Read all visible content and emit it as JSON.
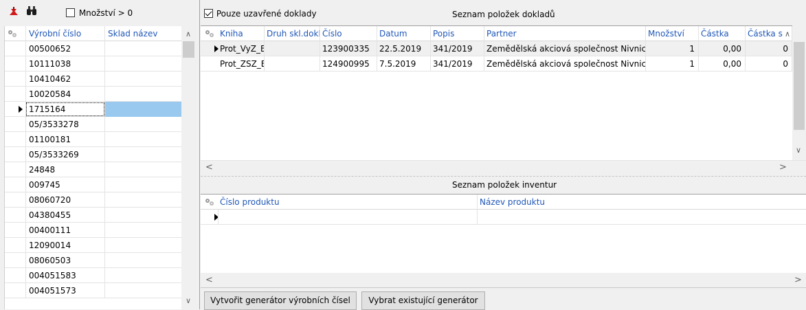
{
  "left": {
    "toolbar": {
      "quantity_filter_label": "Množství > 0"
    },
    "columns": [
      "Výrobní číslo",
      "Sklad název"
    ],
    "rows": [
      {
        "serial": "00500652",
        "warehouse": ""
      },
      {
        "serial": "10111038",
        "warehouse": ""
      },
      {
        "serial": "10410462",
        "warehouse": ""
      },
      {
        "serial": "10020584",
        "warehouse": ""
      },
      {
        "serial": "1715164",
        "warehouse": ""
      },
      {
        "serial": "05/3533278",
        "warehouse": ""
      },
      {
        "serial": "01100181",
        "warehouse": ""
      },
      {
        "serial": "05/3533269",
        "warehouse": ""
      },
      {
        "serial": "24848",
        "warehouse": ""
      },
      {
        "serial": "009745",
        "warehouse": ""
      },
      {
        "serial": "08060720",
        "warehouse": ""
      },
      {
        "serial": "04380455",
        "warehouse": ""
      },
      {
        "serial": "00400111",
        "warehouse": ""
      },
      {
        "serial": "12090014",
        "warehouse": ""
      },
      {
        "serial": "08060503",
        "warehouse": ""
      },
      {
        "serial": "004051583",
        "warehouse": ""
      },
      {
        "serial": "004051573",
        "warehouse": ""
      }
    ],
    "selected_index": 4
  },
  "right": {
    "closed_docs_label": "Pouze uzavřené doklady",
    "doc_items_title": "Seznam položek dokladů",
    "doc_columns": [
      "Kniha",
      "Druh skl.dokl",
      "Číslo",
      "Datum",
      "Popis",
      "Partner",
      "Množství",
      "Částka",
      "Částka s"
    ],
    "doc_rows": [
      {
        "kniha": "Prot_VyZ_E",
        "druh": "",
        "cislo": "123900335",
        "datum": "22.5.2019",
        "popis": "341/2019",
        "partner": "Zemědělská akciová společnost Nivnice",
        "mnozstvi": "1",
        "castka": "0,00",
        "castka_s": "0"
      },
      {
        "kniha": "Prot_ZSZ_E",
        "druh": "",
        "cislo": "124900995",
        "datum": "7.5.2019",
        "popis": "341/2019",
        "partner": "Zemědělská akciová společnost Nivnice",
        "mnozstvi": "1",
        "castka": "0,00",
        "castka_s": "0"
      }
    ],
    "inventory_title": "Seznam položek inventur",
    "inventory_columns": [
      "Číslo produktu",
      "Název produktu"
    ],
    "buttons": {
      "create_generator": "Vytvořit generátor výrobních čísel",
      "select_generator": "Vybrat existující generátor"
    }
  },
  "colors": {
    "header_text": "#1f57b8",
    "selection": "#99c9ef",
    "selected_row_doc": "#f0f0f0"
  }
}
